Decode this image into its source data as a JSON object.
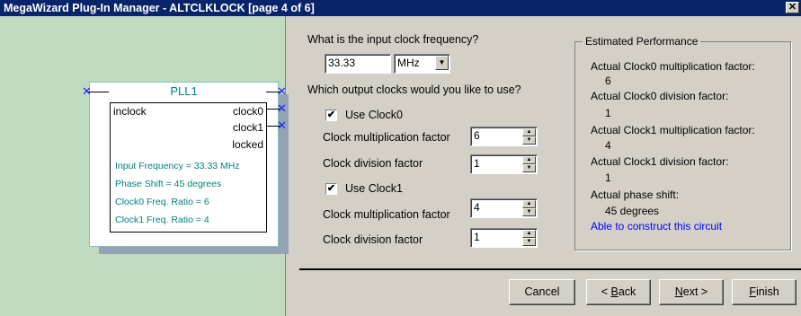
{
  "window": {
    "title": "MegaWizard Plug-In Manager - ALTCLKLOCK [page 4 of 6]",
    "close_glyph": "✕"
  },
  "diagram": {
    "block_name": "PLL1",
    "input_port": "inclock",
    "output_ports": [
      "clock0",
      "clock1",
      "locked"
    ],
    "info_lines": [
      "Input Frequency = 33.33 MHz",
      "Phase Shift = 45 degrees",
      "Clock0 Freq. Ratio = 6",
      "Clock1 Freq. Ratio = 4"
    ]
  },
  "form": {
    "freq_question": "What is the input clock frequency?",
    "freq_value": "33.33",
    "freq_unit": "MHz",
    "outputs_question": "Which output clocks would you like to use?",
    "clock0": {
      "use_label": "Use Clock0",
      "checked": true,
      "mult_label": "Clock multiplication factor",
      "mult_value": "6",
      "div_label": "Clock division factor",
      "div_value": "1"
    },
    "clock1": {
      "use_label": "Use Clock1",
      "checked": true,
      "mult_label": "Clock multiplication factor",
      "mult_value": "4",
      "div_label": "Clock division factor",
      "div_value": "1"
    }
  },
  "performance": {
    "title": "Estimated Performance",
    "c0_mult_label": "Actual Clock0 multiplication factor:",
    "c0_mult_value": "6",
    "c0_div_label": "Actual Clock0 division factor:",
    "c0_div_value": "1",
    "c1_mult_label": "Actual Clock1 multiplication factor:",
    "c1_mult_value": "4",
    "c1_div_label": "Actual Clock1 division factor:",
    "c1_div_value": "1",
    "phase_label": "Actual phase shift:",
    "phase_value": "45 degrees",
    "status": "Able to construct this circuit",
    "status_color": "#0000ff"
  },
  "buttons": {
    "cancel": "Cancel",
    "back_prefix": "< ",
    "back_key": "B",
    "back_rest": "ack",
    "next_key": "N",
    "next_rest": "ext >",
    "finish_key": "F",
    "finish_rest": "inish"
  },
  "colors": {
    "title_bar": "#0a246a",
    "diagram_bg": "#c0dcc0",
    "diagram_text": "#008080",
    "unconnected_marker": "#2020ff"
  },
  "icons": {
    "checkmark": "✔",
    "combo_arrow": "▼",
    "spin_up": "▲",
    "spin_down": "▼",
    "unconnected": "✕"
  }
}
